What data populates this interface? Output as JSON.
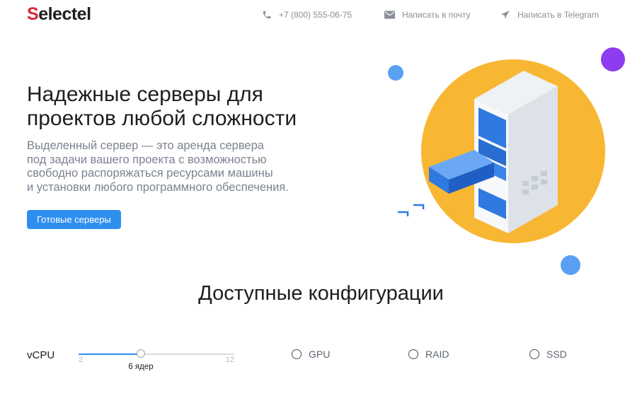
{
  "header": {
    "logo": "Selectel",
    "phone": "+7 (800) 555-06-75",
    "email_label": "Написать в почту",
    "telegram_label": "Написать в Telegram"
  },
  "hero": {
    "title_lines": [
      "Надежные серверы для",
      "проектов любой сложности"
    ],
    "description_lines": [
      "Выделенный сервер — это аренда сервера",
      "под задачи вашего проекта с возможностью",
      "свободно распоряжаться ресурсами машины",
      "и установки любого программного обеспечения."
    ],
    "cta_label": "Готовые серверы"
  },
  "section": {
    "title": "Доступные конфигурации"
  },
  "filters": {
    "vcpu": {
      "label": "vCPU",
      "min": "2",
      "max": "12",
      "value": 6,
      "value_label": "6 ядер"
    },
    "options": [
      {
        "label": "GPU",
        "checked": false
      },
      {
        "label": "RAID",
        "checked": false
      },
      {
        "label": "SSD",
        "checked": false
      }
    ]
  },
  "colors": {
    "accent": "#2f8fef",
    "brand_red": "#d8283b",
    "illustration_circle": "#f8b733",
    "purple_dot": "#8d3cf0",
    "blue_dot": "#5aa0f2"
  }
}
